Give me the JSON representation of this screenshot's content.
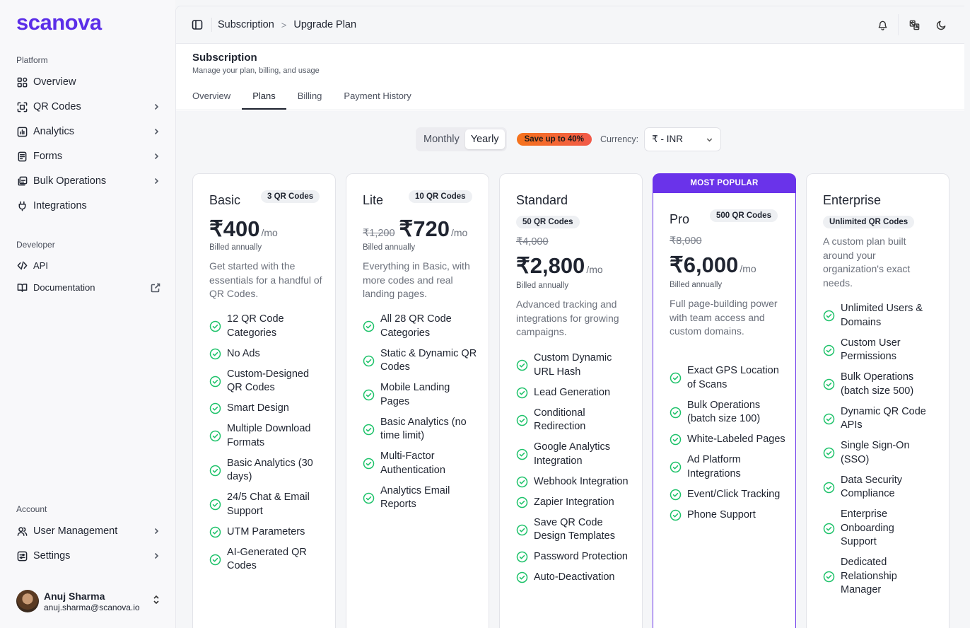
{
  "brand": {
    "logo": "scanova"
  },
  "sidebar": {
    "sections": {
      "platform": "Platform",
      "developer": "Developer",
      "account": "Account"
    },
    "platform_items": [
      {
        "label": "Overview"
      },
      {
        "label": "QR Codes"
      },
      {
        "label": "Analytics"
      },
      {
        "label": "Forms"
      },
      {
        "label": "Bulk Operations"
      },
      {
        "label": "Integrations"
      }
    ],
    "developer_items": [
      {
        "label": "API"
      },
      {
        "label": "Documentation"
      }
    ],
    "account_items": [
      {
        "label": "User Management"
      },
      {
        "label": "Settings"
      }
    ],
    "user": {
      "name": "Anuj Sharma",
      "email": "anuj.sharma@scanova.io"
    }
  },
  "topbar": {
    "breadcrumb": [
      "Subscription",
      "Upgrade Plan"
    ]
  },
  "page": {
    "title": "Subscription",
    "subtitle": "Manage your plan, billing, and usage",
    "tabs": [
      "Overview",
      "Plans",
      "Billing",
      "Payment History"
    ],
    "active_tab": "Plans"
  },
  "billing": {
    "monthly": "Monthly",
    "yearly": "Yearly",
    "selected": "Yearly",
    "save_badge": "Save up to 40%",
    "currency_label": "Currency:",
    "currency_value": "₹ - INR"
  },
  "plans": [
    {
      "name": "Basic",
      "badge": "3 QR Codes",
      "strike": "",
      "price": "₹400",
      "per": "/mo",
      "billed": "Billed annually",
      "desc": "Get started with the essentials for a handful of QR Codes.",
      "features": [
        "12 QR Code Categories",
        "No Ads",
        "Custom-Designed QR Codes",
        "Smart Design",
        "Multiple Download Formats",
        "Basic Analytics (30 days)",
        "24/5 Chat & Email Support",
        "UTM Parameters",
        "AI-Generated QR Codes"
      ]
    },
    {
      "name": "Lite",
      "badge": "10 QR Codes",
      "strike": "₹1,200",
      "price": "₹720",
      "per": "/mo",
      "billed": "Billed annually",
      "desc": "Everything in Basic, with more codes and real landing pages.",
      "features": [
        "All 28 QR Code Categories",
        "Static & Dynamic QR Codes",
        "Mobile Landing Pages",
        "Basic Analytics (no time limit)",
        "Multi-Factor Authentication",
        "Analytics Email Reports"
      ]
    },
    {
      "name": "Standard",
      "badge": "50 QR Codes",
      "strike": "₹4,000",
      "price": "₹2,800",
      "per": "/mo",
      "billed": "Billed annually",
      "desc": "Advanced tracking and integrations for growing campaigns.",
      "features": [
        "Custom Dynamic URL Hash",
        "Lead Generation",
        "Conditional Redirection",
        "Google Analytics Integration",
        "Webhook Integration",
        "Zapier Integration",
        "Save QR Code Design Templates",
        "Password Protection",
        "Auto-Deactivation"
      ]
    },
    {
      "name": "Pro",
      "badge": "500 QR Codes",
      "banner": "MOST POPULAR",
      "strike": "₹8,000",
      "price": "₹6,000",
      "per": "/mo",
      "billed": "Billed annually",
      "desc": "Full page-building power with team access and custom domains.",
      "features": [
        "Exact GPS Location of Scans",
        "Bulk Operations (batch size 100)",
        "White-Labeled Pages",
        "Ad Platform Integrations",
        "Event/Click Tracking",
        "Phone Support"
      ]
    },
    {
      "name": "Enterprise",
      "badge": "Unlimited QR Codes",
      "strike": "",
      "price": "",
      "per": "",
      "billed": "",
      "desc": "A custom plan built around your organization's exact needs.",
      "features": [
        "Unlimited Users & Domains",
        "Custom User Permissions",
        "Bulk Operations (batch size 500)",
        "Dynamic QR Code APIs",
        "Single Sign-On (SSO)",
        "Data Security Compliance",
        "Enterprise Onboarding Support",
        "Dedicated Relationship Manager"
      ]
    }
  ],
  "colors": {
    "brand": "#5b2ee8",
    "accent": "#6a33ea",
    "check": "#1ec26a",
    "save_badge_start": "#f5731c",
    "save_badge_end": "#f25a4a"
  }
}
